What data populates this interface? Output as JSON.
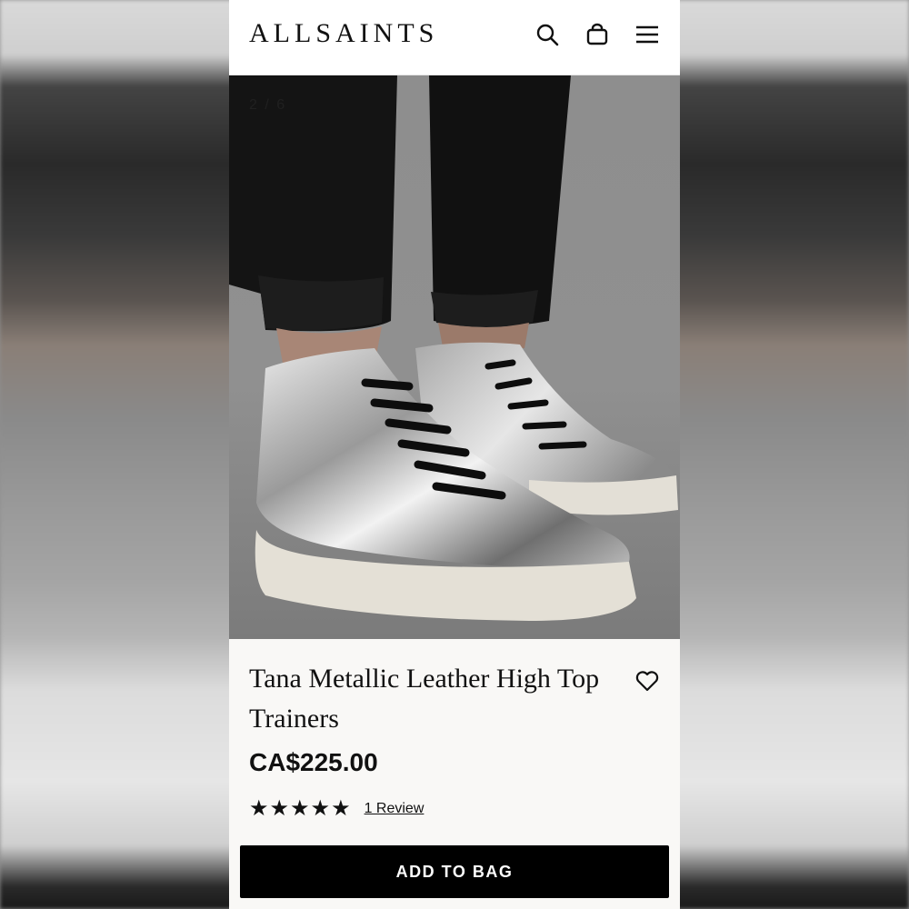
{
  "header": {
    "logo": "ALLSAINTS",
    "icons": [
      "search-icon",
      "bag-icon",
      "menu-icon"
    ]
  },
  "gallery": {
    "counter": "2 / 6",
    "image_description_icon": "product-photo"
  },
  "product": {
    "title": "Tana Metallic Leather High Top Trainers",
    "price": "CA$225.00",
    "rating_stars": "★★★★★",
    "rating_value": 5,
    "rating_max": 5,
    "review_link": "1 Review"
  },
  "actions": {
    "add_to_bag": "ADD TO BAG"
  },
  "colors": {
    "brand_text": "#111111",
    "button_bg": "#000000",
    "button_text": "#ffffff",
    "page_bg": "#f9f8f6"
  }
}
